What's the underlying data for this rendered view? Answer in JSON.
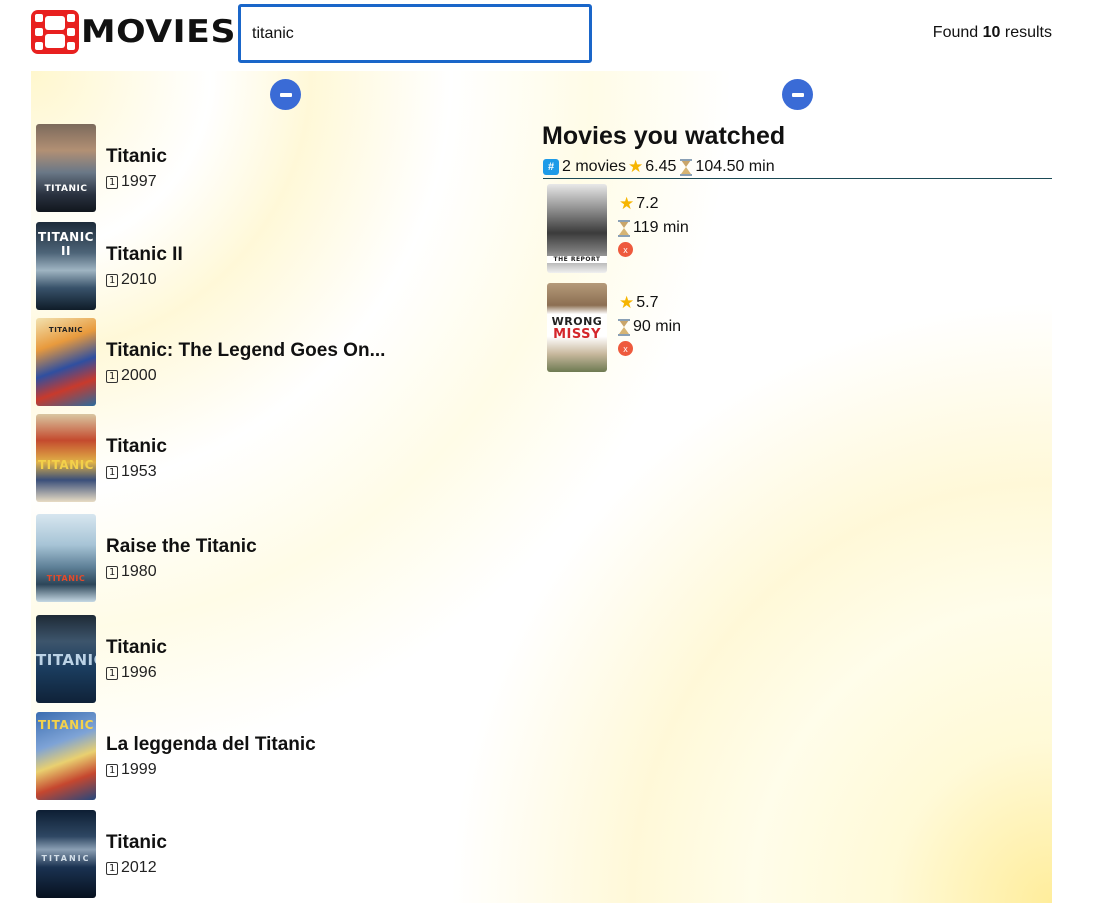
{
  "app": {
    "logo_text": "MOVIES"
  },
  "search": {
    "value": "titanic",
    "placeholder": ""
  },
  "found": {
    "prefix": "Found",
    "count": "10",
    "suffix": "results"
  },
  "results": [
    {
      "title": "Titanic",
      "year": "1997"
    },
    {
      "title": "Titanic II",
      "year": "2010"
    },
    {
      "title": "Titanic: The Legend Goes On...",
      "year": "2000"
    },
    {
      "title": "Titanic",
      "year": "1953"
    },
    {
      "title": "Raise the Titanic",
      "year": "1980"
    },
    {
      "title": "Titanic",
      "year": "1996"
    },
    {
      "title": "La leggenda del Titanic",
      "year": "1999"
    },
    {
      "title": "Titanic",
      "year": "2012"
    }
  ],
  "watched": {
    "title": "Movies you watched",
    "count_label": "2 movies",
    "avg_rating": "6.45",
    "total_runtime": "104.50 min",
    "items": [
      {
        "rating": "7.2",
        "runtime": "119 min",
        "remove_label": "x"
      },
      {
        "rating": "5.7",
        "runtime": "90 min",
        "remove_label": "x"
      }
    ]
  },
  "icons": {
    "year": "calendar-icon",
    "count": "hash-icon",
    "rating": "star-icon",
    "runtime": "hourglass-icon",
    "collapse": "minus-icon"
  },
  "colors": {
    "accent": "#3a6bd6",
    "search_border": "#1a66c9",
    "logo_red": "#e8201f",
    "remove": "#ee5a3d",
    "star": "#f6b500"
  }
}
